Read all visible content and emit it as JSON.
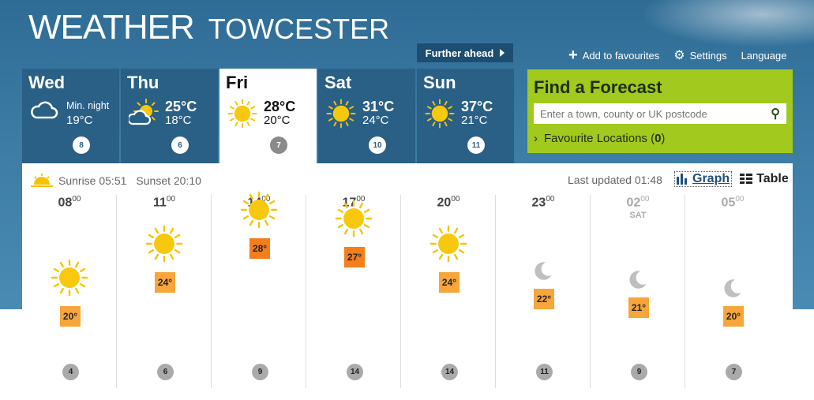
{
  "brand": {
    "weather": "WEATHER",
    "town": "TOWCESTER"
  },
  "nav": {
    "further_ahead": "Further ahead",
    "add_favourites": "Add to favourites",
    "settings": "Settings",
    "language": "Language"
  },
  "days": [
    {
      "name": "Wed",
      "icon": "cloud-night-icon",
      "label": "Min. night",
      "low": "19°C",
      "wind": "8"
    },
    {
      "name": "Thu",
      "icon": "sun-cloud-icon",
      "high": "25°C",
      "low": "18°C",
      "wind": "6"
    },
    {
      "name": "Fri",
      "icon": "sun-icon",
      "high": "28°C",
      "low": "20°C",
      "wind": "7"
    },
    {
      "name": "Sat",
      "icon": "sun-icon",
      "high": "31°C",
      "low": "24°C",
      "wind": "10"
    },
    {
      "name": "Sun",
      "icon": "sun-icon",
      "high": "37°C",
      "low": "21°C",
      "wind": "11"
    }
  ],
  "find": {
    "title": "Find a Forecast",
    "placeholder": "Enter a town, county or UK postcode",
    "fav_label": "Favourite Locations (",
    "fav_count": "0",
    "fav_close": ")"
  },
  "sun": {
    "sunrise": "Sunrise 05:51",
    "sunset": "Sunset 20:10"
  },
  "updated": "Last updated 01:48",
  "view": {
    "graph": "Graph",
    "table": "Table"
  },
  "hours": [
    {
      "h": "08",
      "m": "00",
      "icon": "sun-icon",
      "temp": "20°",
      "wind": "4"
    },
    {
      "h": "11",
      "m": "00",
      "icon": "sun-icon",
      "temp": "24°",
      "wind": "6"
    },
    {
      "h": "14",
      "m": "00",
      "icon": "sun-icon",
      "temp": "28°",
      "wind": "9"
    },
    {
      "h": "17",
      "m": "00",
      "icon": "sun-icon",
      "temp": "27°",
      "wind": "14"
    },
    {
      "h": "20",
      "m": "00",
      "icon": "sun-icon",
      "temp": "24°",
      "wind": "14"
    },
    {
      "h": "23",
      "m": "00",
      "icon": "moon-icon",
      "temp": "22°",
      "wind": "11"
    },
    {
      "h": "02",
      "m": "00",
      "day": "SAT",
      "icon": "moon-icon",
      "temp": "21°",
      "wind": "9"
    },
    {
      "h": "05",
      "m": "00",
      "icon": "moon-icon",
      "temp": "20°",
      "wind": "7"
    }
  ],
  "colors": {
    "sky": "#2f6c95",
    "day_tab": "#2a5f86",
    "find_bg": "#a2c91d",
    "temp_orange": "#f39a1e",
    "sun": "#f5c400"
  }
}
